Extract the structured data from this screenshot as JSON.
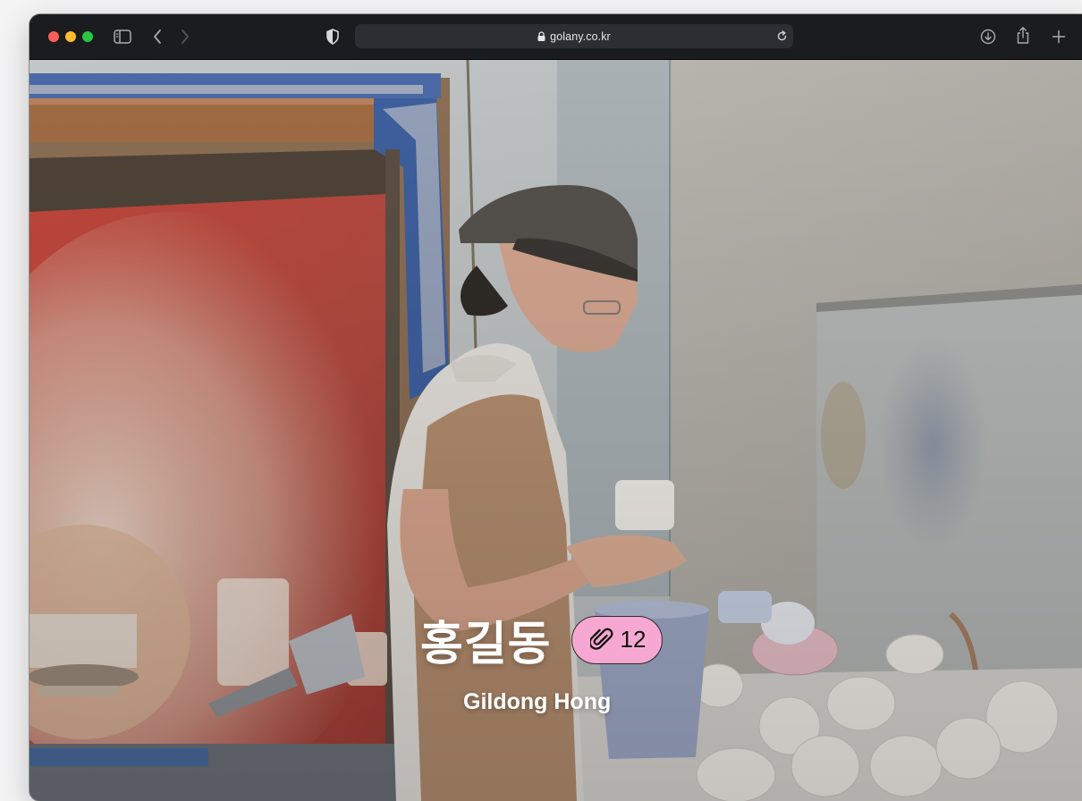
{
  "browser": {
    "url": "golany.co.kr"
  },
  "profile": {
    "name_korean": "홍길동",
    "name_english": "Gildong Hong",
    "attachment_count": "12"
  },
  "colors": {
    "badge_background": "#f7a8d2",
    "traffic_close": "#ff5f57",
    "traffic_minimize": "#febc2e",
    "traffic_zoom": "#28c840"
  }
}
